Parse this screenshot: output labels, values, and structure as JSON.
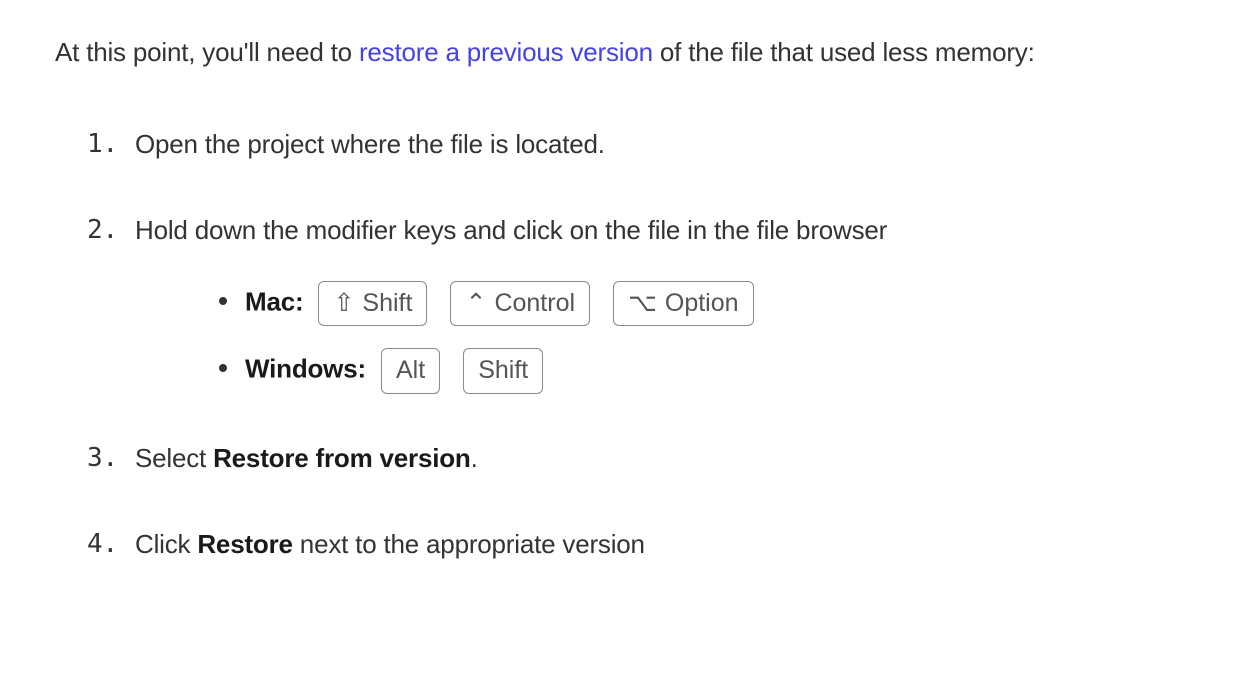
{
  "intro": {
    "before_link": "At this point, you'll need to ",
    "link_text": "restore a previous version",
    "after_link": " of the file that used less memory:"
  },
  "steps": {
    "s1": "Open the project where the file is located.",
    "s2": "Hold down the modifier keys and click on the file in the file browser",
    "s2_platforms": {
      "mac": {
        "label": "Mac:",
        "keys": {
          "k1_sym": "⇧",
          "k1_text": "Shift",
          "k2_sym": "⌃",
          "k2_text": "Control",
          "k3_sym": "⌥",
          "k3_text": "Option"
        }
      },
      "win": {
        "label": "Windows:",
        "keys": {
          "k1_text": "Alt",
          "k2_text": "Shift"
        }
      }
    },
    "s3_before": "Select ",
    "s3_bold": "Restore from version",
    "s3_after": ".",
    "s4_before": "Click ",
    "s4_bold": "Restore",
    "s4_after": " next to the appropriate version"
  }
}
